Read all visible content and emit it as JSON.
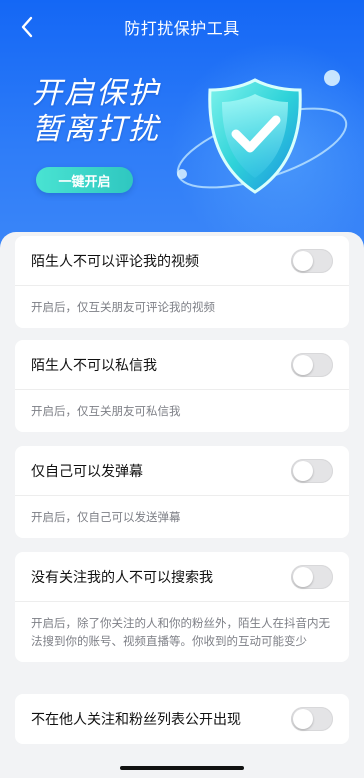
{
  "header": {
    "title": "防打扰保护工具",
    "back_icon": "chevron-left-icon"
  },
  "hero": {
    "slogan_line1": "开启保护",
    "slogan_line2": "暂离打扰",
    "one_key_button": "一键开启"
  },
  "settings": [
    {
      "title": "陌生人不可以评论我的视频",
      "desc": "开启后，仅互关朋友可评论我的视频",
      "enabled": false
    },
    {
      "title": "陌生人不可以私信我",
      "desc": "开启后，仅互关朋友可私信我",
      "enabled": false
    },
    {
      "title": "仅自己可以发弹幕",
      "desc": "开启后，仅自己可以发送弹幕",
      "enabled": false
    },
    {
      "title": "没有关注我的人不可以搜索我",
      "desc": "开启后，除了你关注的人和你的粉丝外，陌生人在抖音内无法搜到你的账号、视频直播等。你收到的互动可能变少",
      "enabled": false
    },
    {
      "title": "不在他人关注和粉丝列表公开出现",
      "enabled": false
    }
  ],
  "colors": {
    "hero_blue": "#1467f5",
    "button_teal": "#49e3d2",
    "toggle_off": "#e4e4e6"
  }
}
